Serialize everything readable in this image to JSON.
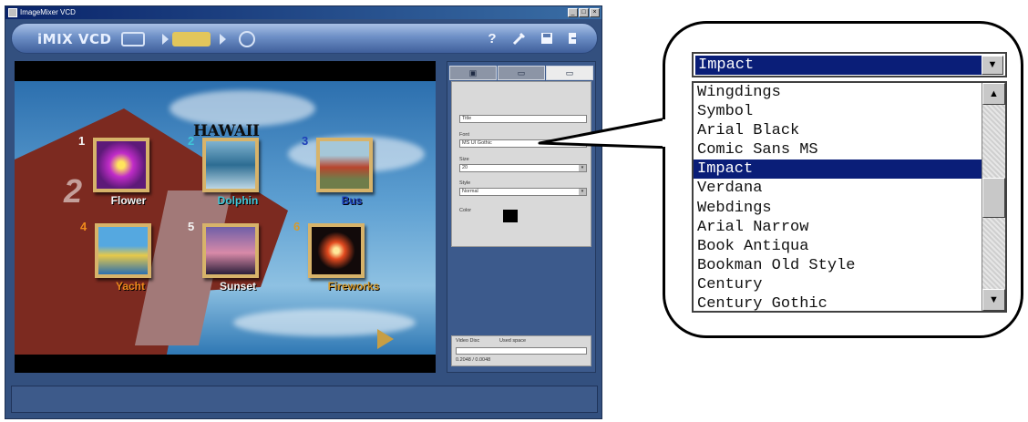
{
  "window": {
    "title": "ImageMixer VCD",
    "controls": [
      "_",
      "□",
      "×"
    ]
  },
  "toolbar": {
    "logo": "iMIX VCD",
    "help_label": "?",
    "icons": [
      "help-icon",
      "wrench-icon",
      "save-icon",
      "exit-icon"
    ]
  },
  "disc_menu": {
    "title": "HAWAII",
    "items": [
      {
        "number": "1",
        "label": "Flower",
        "label_color": "#f4f4f4",
        "number_color": "#f4f4f4"
      },
      {
        "number": "2",
        "label": "Dolphin",
        "label_color": "#3ec7d8",
        "number_color": "#3ec7d8"
      },
      {
        "number": "3",
        "label": "Bus",
        "label_color": "#1d3fb8",
        "number_color": "#1d3fb8"
      },
      {
        "number": "4",
        "label": "Yacht",
        "label_color": "#f08a1c",
        "number_color": "#f08a1c"
      },
      {
        "number": "5",
        "label": "Sunset",
        "label_color": "#f4f4f4",
        "number_color": "#f4f4f4"
      },
      {
        "number": "6",
        "label": "Fireworks",
        "label_color": "#d59a2c",
        "number_color": "#d59a2c"
      }
    ],
    "bottom_button": "H"
  },
  "panel": {
    "title_label": "Title",
    "font_label": "Font",
    "font_value": "MS UI Gothic",
    "size_label": "Size",
    "size_value": "20",
    "style_label": "Style",
    "style_value": "Normal",
    "color_label": "Color",
    "color_value": "#000000",
    "video_disc_label": "Video Disc",
    "used_space_label": "Used space",
    "used_space_value": "0.2048 / 0.0048"
  },
  "font_dropdown": {
    "selected": "Impact",
    "options": [
      "Wingdings",
      "Symbol",
      "Arial Black",
      "Comic Sans MS",
      "Impact",
      "Verdana",
      "Webdings",
      "Arial Narrow",
      "Book Antiqua",
      "Bookman Old Style",
      "Century",
      "Century Gothic"
    ],
    "highlight_color": "#0a1e78"
  }
}
